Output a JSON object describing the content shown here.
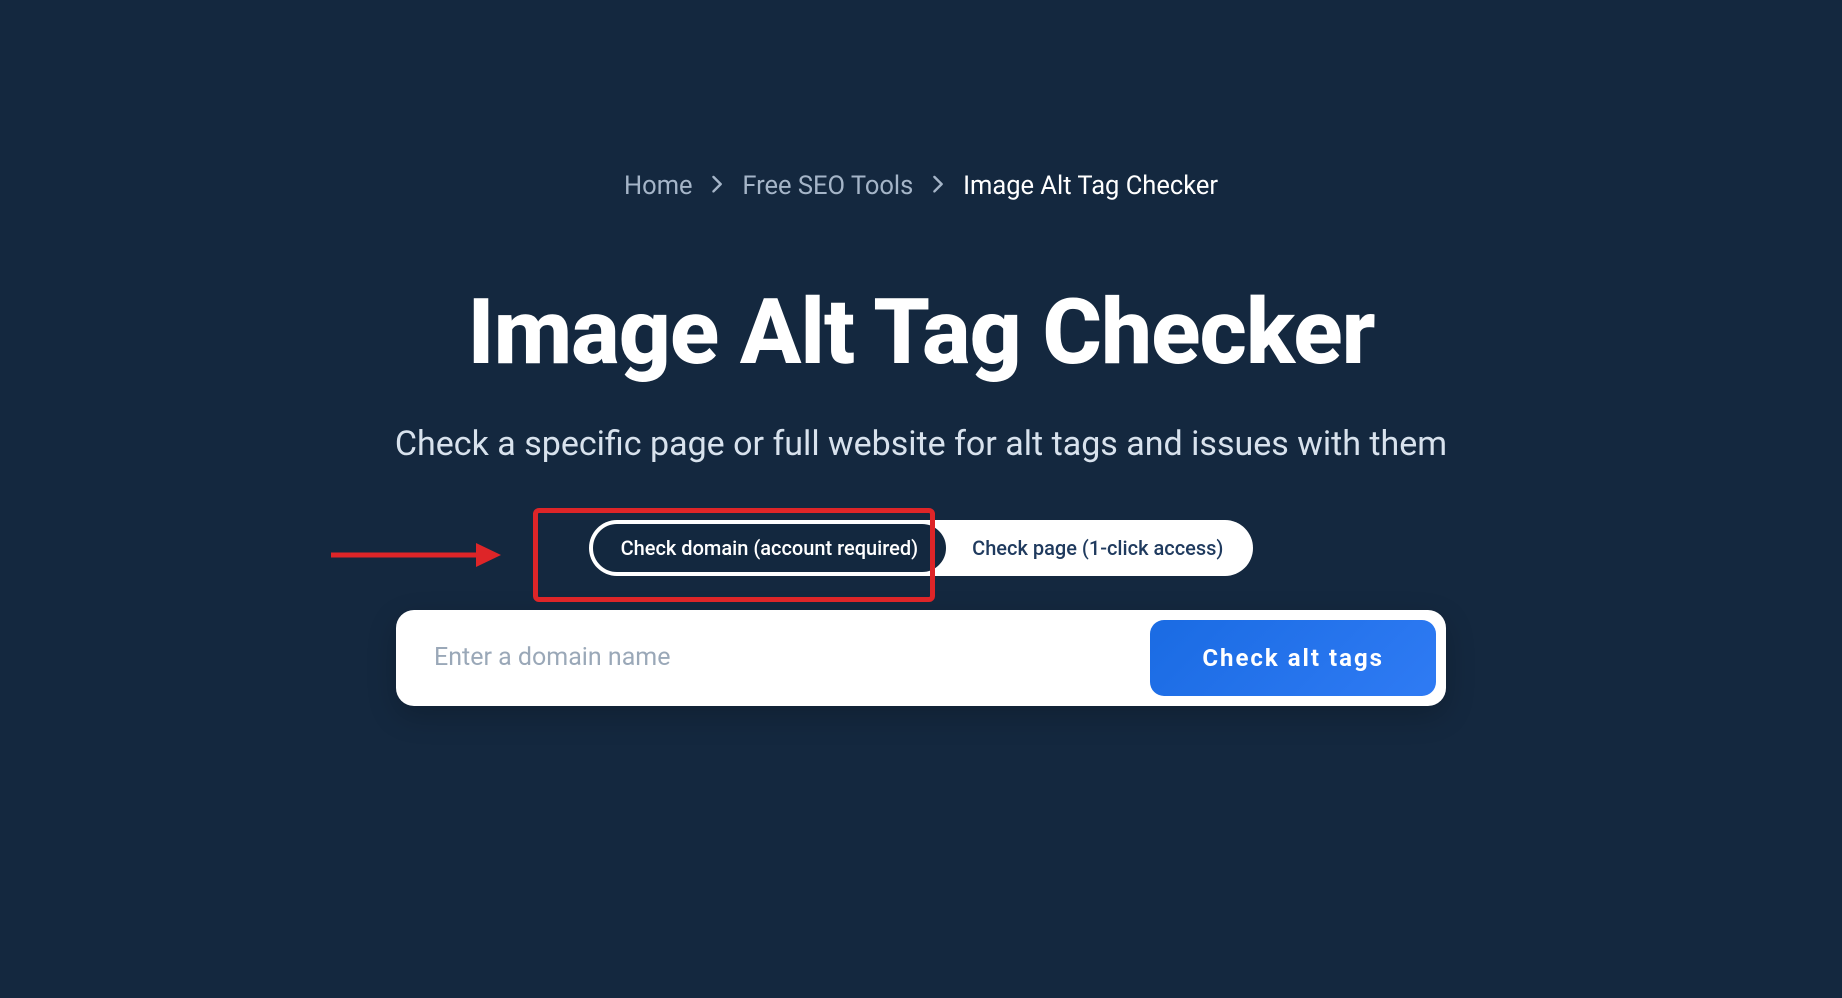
{
  "breadcrumb": {
    "home": "Home",
    "tools": "Free SEO Tools",
    "current": "Image Alt Tag Checker"
  },
  "hero": {
    "title": "Image Alt Tag Checker",
    "subtitle": "Check a specific page or full website for alt tags and issues with them"
  },
  "toggle": {
    "domain": "Check domain (account required)",
    "page": "Check page (1-click access)"
  },
  "search": {
    "placeholder": "Enter a domain name",
    "button": "Check alt tags"
  }
}
